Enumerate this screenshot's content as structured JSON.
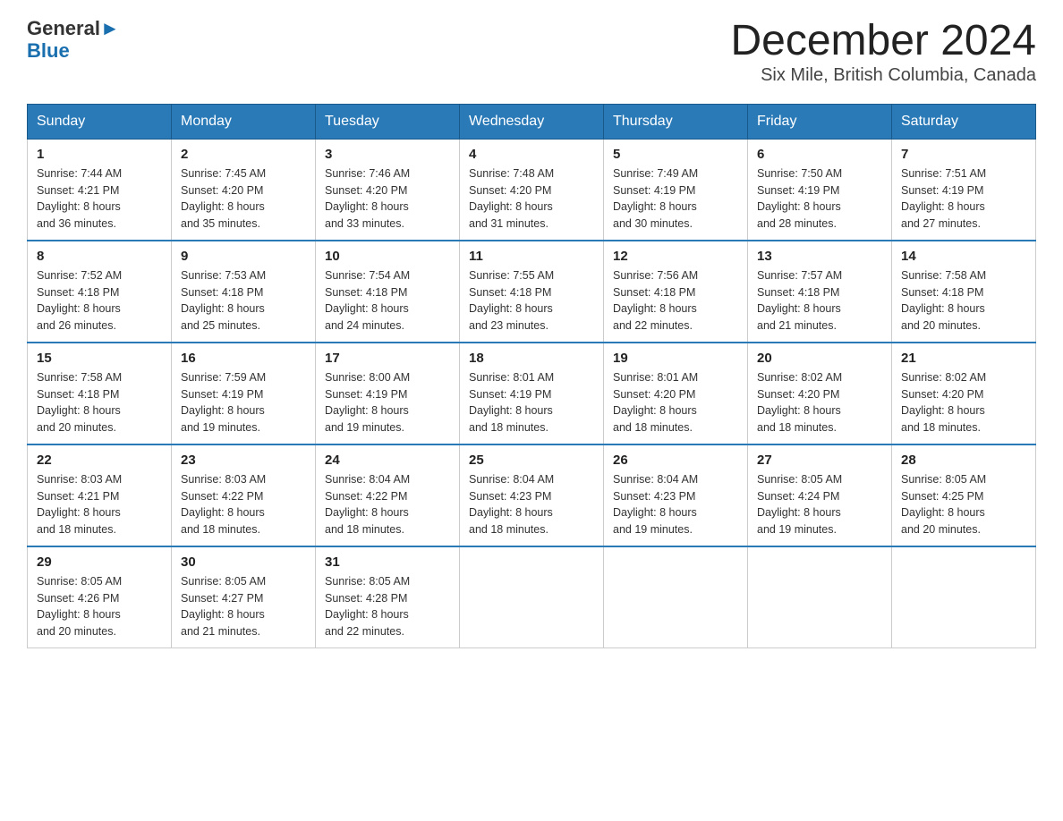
{
  "logo": {
    "general": "General",
    "blue": "Blue",
    "arrow": "▶"
  },
  "header": {
    "title": "December 2024",
    "subtitle": "Six Mile, British Columbia, Canada"
  },
  "days_header": [
    "Sunday",
    "Monday",
    "Tuesday",
    "Wednesday",
    "Thursday",
    "Friday",
    "Saturday"
  ],
  "weeks": [
    [
      {
        "num": "1",
        "sunrise": "7:44 AM",
        "sunset": "4:21 PM",
        "daylight": "8 hours and 36 minutes."
      },
      {
        "num": "2",
        "sunrise": "7:45 AM",
        "sunset": "4:20 PM",
        "daylight": "8 hours and 35 minutes."
      },
      {
        "num": "3",
        "sunrise": "7:46 AM",
        "sunset": "4:20 PM",
        "daylight": "8 hours and 33 minutes."
      },
      {
        "num": "4",
        "sunrise": "7:48 AM",
        "sunset": "4:20 PM",
        "daylight": "8 hours and 31 minutes."
      },
      {
        "num": "5",
        "sunrise": "7:49 AM",
        "sunset": "4:19 PM",
        "daylight": "8 hours and 30 minutes."
      },
      {
        "num": "6",
        "sunrise": "7:50 AM",
        "sunset": "4:19 PM",
        "daylight": "8 hours and 28 minutes."
      },
      {
        "num": "7",
        "sunrise": "7:51 AM",
        "sunset": "4:19 PM",
        "daylight": "8 hours and 27 minutes."
      }
    ],
    [
      {
        "num": "8",
        "sunrise": "7:52 AM",
        "sunset": "4:18 PM",
        "daylight": "8 hours and 26 minutes."
      },
      {
        "num": "9",
        "sunrise": "7:53 AM",
        "sunset": "4:18 PM",
        "daylight": "8 hours and 25 minutes."
      },
      {
        "num": "10",
        "sunrise": "7:54 AM",
        "sunset": "4:18 PM",
        "daylight": "8 hours and 24 minutes."
      },
      {
        "num": "11",
        "sunrise": "7:55 AM",
        "sunset": "4:18 PM",
        "daylight": "8 hours and 23 minutes."
      },
      {
        "num": "12",
        "sunrise": "7:56 AM",
        "sunset": "4:18 PM",
        "daylight": "8 hours and 22 minutes."
      },
      {
        "num": "13",
        "sunrise": "7:57 AM",
        "sunset": "4:18 PM",
        "daylight": "8 hours and 21 minutes."
      },
      {
        "num": "14",
        "sunrise": "7:58 AM",
        "sunset": "4:18 PM",
        "daylight": "8 hours and 20 minutes."
      }
    ],
    [
      {
        "num": "15",
        "sunrise": "7:58 AM",
        "sunset": "4:18 PM",
        "daylight": "8 hours and 20 minutes."
      },
      {
        "num": "16",
        "sunrise": "7:59 AM",
        "sunset": "4:19 PM",
        "daylight": "8 hours and 19 minutes."
      },
      {
        "num": "17",
        "sunrise": "8:00 AM",
        "sunset": "4:19 PM",
        "daylight": "8 hours and 19 minutes."
      },
      {
        "num": "18",
        "sunrise": "8:01 AM",
        "sunset": "4:19 PM",
        "daylight": "8 hours and 18 minutes."
      },
      {
        "num": "19",
        "sunrise": "8:01 AM",
        "sunset": "4:20 PM",
        "daylight": "8 hours and 18 minutes."
      },
      {
        "num": "20",
        "sunrise": "8:02 AM",
        "sunset": "4:20 PM",
        "daylight": "8 hours and 18 minutes."
      },
      {
        "num": "21",
        "sunrise": "8:02 AM",
        "sunset": "4:20 PM",
        "daylight": "8 hours and 18 minutes."
      }
    ],
    [
      {
        "num": "22",
        "sunrise": "8:03 AM",
        "sunset": "4:21 PM",
        "daylight": "8 hours and 18 minutes."
      },
      {
        "num": "23",
        "sunrise": "8:03 AM",
        "sunset": "4:22 PM",
        "daylight": "8 hours and 18 minutes."
      },
      {
        "num": "24",
        "sunrise": "8:04 AM",
        "sunset": "4:22 PM",
        "daylight": "8 hours and 18 minutes."
      },
      {
        "num": "25",
        "sunrise": "8:04 AM",
        "sunset": "4:23 PM",
        "daylight": "8 hours and 18 minutes."
      },
      {
        "num": "26",
        "sunrise": "8:04 AM",
        "sunset": "4:23 PM",
        "daylight": "8 hours and 19 minutes."
      },
      {
        "num": "27",
        "sunrise": "8:05 AM",
        "sunset": "4:24 PM",
        "daylight": "8 hours and 19 minutes."
      },
      {
        "num": "28",
        "sunrise": "8:05 AM",
        "sunset": "4:25 PM",
        "daylight": "8 hours and 20 minutes."
      }
    ],
    [
      {
        "num": "29",
        "sunrise": "8:05 AM",
        "sunset": "4:26 PM",
        "daylight": "8 hours and 20 minutes."
      },
      {
        "num": "30",
        "sunrise": "8:05 AM",
        "sunset": "4:27 PM",
        "daylight": "8 hours and 21 minutes."
      },
      {
        "num": "31",
        "sunrise": "8:05 AM",
        "sunset": "4:28 PM",
        "daylight": "8 hours and 22 minutes."
      },
      null,
      null,
      null,
      null
    ]
  ],
  "labels": {
    "sunrise": "Sunrise:",
    "sunset": "Sunset:",
    "daylight": "Daylight:"
  }
}
